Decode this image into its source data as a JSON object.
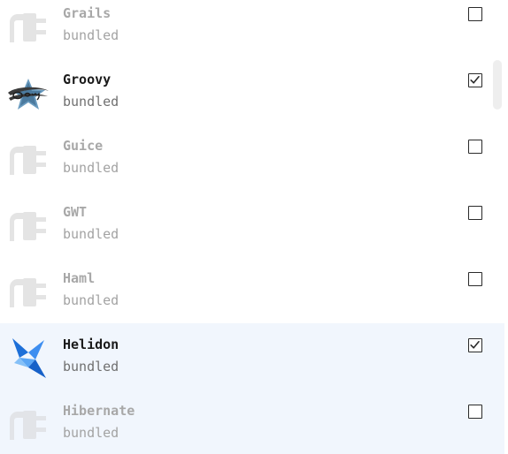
{
  "plugins": [
    {
      "name": "Grails",
      "source": "bundled",
      "checked": false,
      "icon": "plug-icon"
    },
    {
      "name": "Groovy",
      "source": "bundled",
      "checked": true,
      "icon": "groovy-star-logo"
    },
    {
      "name": "Guice",
      "source": "bundled",
      "checked": false,
      "icon": "plug-icon"
    },
    {
      "name": "GWT",
      "source": "bundled",
      "checked": false,
      "icon": "plug-icon"
    },
    {
      "name": "Haml",
      "source": "bundled",
      "checked": false,
      "icon": "plug-icon"
    },
    {
      "name": "Helidon",
      "source": "bundled",
      "checked": true,
      "icon": "helidon-logo"
    },
    {
      "name": "Hibernate",
      "source": "bundled",
      "checked": false,
      "icon": "plug-icon"
    }
  ],
  "colors": {
    "selected_row_bg": "#f1f6fd",
    "disabled_text": "#a8a8a8",
    "enabled_text": "#1b1b1b",
    "plug_icon": "#e2e2e2"
  }
}
